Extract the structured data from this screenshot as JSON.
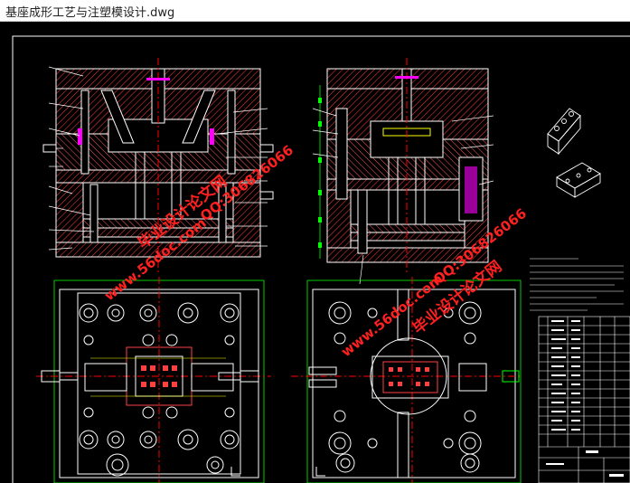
{
  "window": {
    "title": "基座成形工艺与注塑模设计.dwg"
  },
  "watermarks": {
    "site": "毕业设计论文网",
    "url": "www.56doc.com",
    "qq": "QQ:306826066"
  },
  "colors": {
    "background": "#000000",
    "outline": "#ffffff",
    "hatch": "#ff4040",
    "centerline": "#ff0000",
    "dimension": "#00ff00",
    "highlight": "#ff00ff",
    "cyan": "#00ffff",
    "yellow": "#ffff00",
    "watermark": "#ff2020"
  },
  "views": [
    {
      "name": "main-section-view"
    },
    {
      "name": "side-section-view"
    },
    {
      "name": "moving-half-plan-view"
    },
    {
      "name": "fixed-half-plan-view"
    },
    {
      "name": "part-isometric-view"
    },
    {
      "name": "title-block"
    }
  ]
}
